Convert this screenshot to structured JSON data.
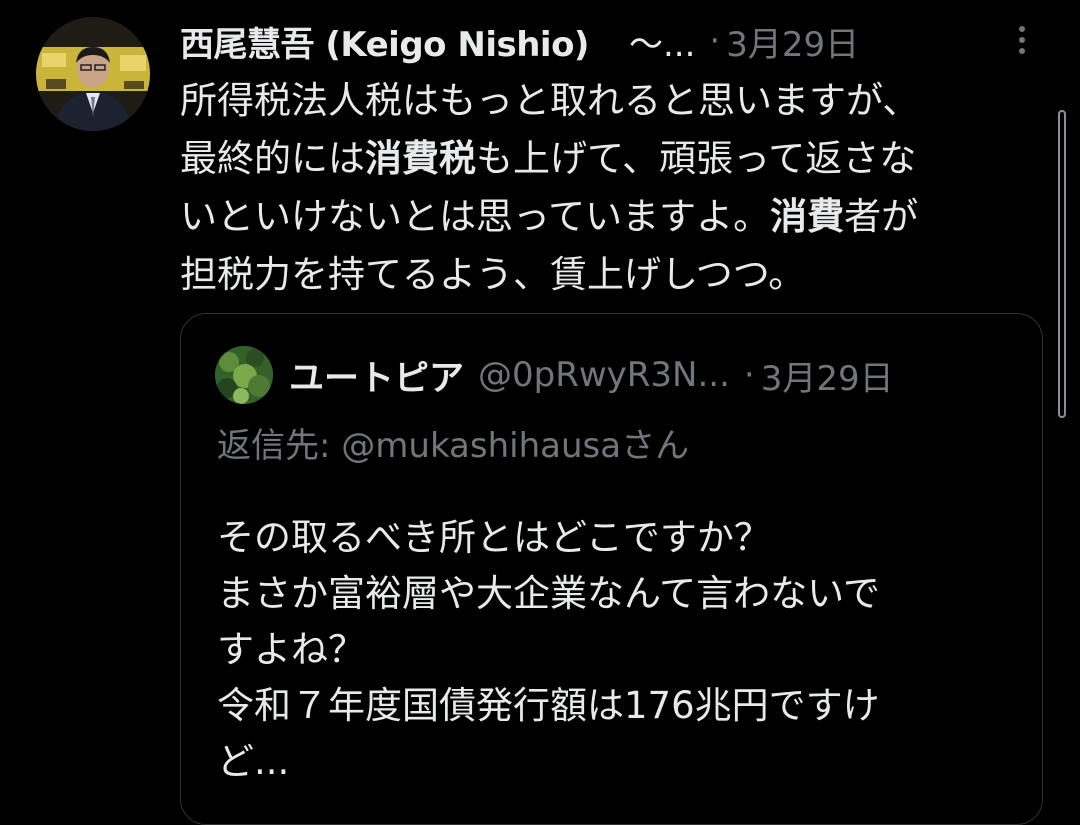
{
  "tweet": {
    "author_name": "西尾慧吾 (Keigo Nishio)",
    "author_handle": "〜...",
    "separator": "·",
    "date": "3月29日",
    "body_lines": [
      [
        {
          "t": "所得税法人税はもっと取れると思いますが、",
          "b": false
        }
      ],
      [
        {
          "t": "最終的には",
          "b": false
        },
        {
          "t": "消費税",
          "b": true
        },
        {
          "t": "も上げて、頑張って返さな",
          "b": false
        }
      ],
      [
        {
          "t": "いといけないとは思っていますよ。",
          "b": false
        },
        {
          "t": "消費",
          "b": true
        },
        {
          "t": "者が",
          "b": false
        }
      ],
      [
        {
          "t": "担税力を持てるよう、賃上げしつつ。",
          "b": false
        }
      ]
    ]
  },
  "quote": {
    "name": "ユートピア",
    "handle": "@0pRwyR3N...",
    "separator": "·",
    "date": "3月29日",
    "reply_label": "返信先:",
    "reply_mention": "@mukashihausa",
    "reply_suffix": "さん",
    "lines": [
      "その取るべき所とはどこですか？",
      "まさか富裕層や大企業なんて言わないで",
      "すよね？",
      "令和７年度国債発行額は176兆円ですけ",
      "ど..."
    ]
  },
  "icons": {
    "more": "more-vertical-icon"
  },
  "colors": {
    "background": "#000000",
    "text_primary": "#e7e9ea",
    "text_secondary": "#71767b",
    "border": "#2f3336"
  }
}
